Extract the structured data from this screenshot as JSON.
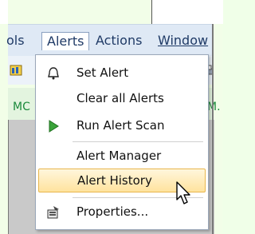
{
  "menubar": {
    "tools_label": "ols",
    "alerts_label": "Alerts",
    "actions_label": "Actions",
    "window_label": "Window"
  },
  "tabs": {
    "left": "MC",
    "right": "M."
  },
  "dropdown": {
    "items": [
      {
        "label": "Set Alert",
        "icon": "bell-icon"
      },
      {
        "label": "Clear all Alerts",
        "icon": ""
      },
      {
        "label": "Run Alert Scan",
        "icon": "play-icon"
      },
      {
        "label": "Alert Manager",
        "icon": ""
      },
      {
        "label": "Alert History",
        "icon": "",
        "highlighted": true
      },
      {
        "label": "Properties...",
        "icon": "properties-icon"
      }
    ]
  },
  "colors": {
    "menubar_bg": "#dfe9f5",
    "highlight_border": "#e8b64c",
    "play_green": "#3aa33a",
    "tab_text_green": "#1c8a3c"
  }
}
